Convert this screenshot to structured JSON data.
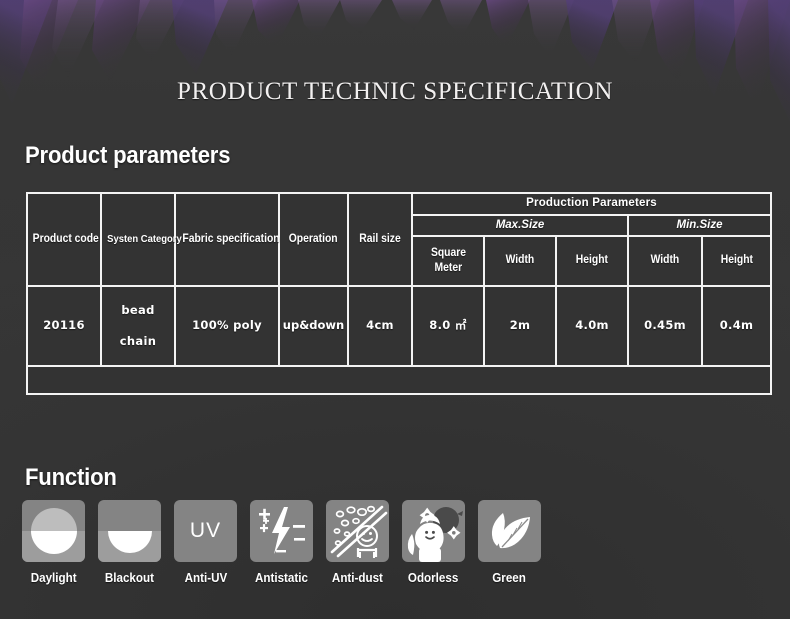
{
  "page": {
    "title": "PRODUCT TECHNIC SPECIFICATION",
    "background_color": "#383838",
    "accent_color": "#5a3a6e",
    "text_color": "#ffffff"
  },
  "sections": {
    "product_parameters_heading": "Product parameters",
    "function_heading": "Function"
  },
  "table": {
    "group_header": "Production Parameters",
    "subgroups": [
      {
        "label": "Max.Size"
      },
      {
        "label": "Min.Size"
      }
    ],
    "columns": [
      "Product code",
      "Systen Category",
      "Fabric specification",
      "Operation",
      "Rail size",
      "Square Meter",
      "Width",
      "Height",
      "Width",
      "Height"
    ],
    "column_square_meter_line1": "Square",
    "column_square_meter_line2": "Meter",
    "rows": [
      {
        "product_code": "20116",
        "system_category_line1": "bead",
        "system_category_line2": "chain",
        "fabric_specification": "100% poly",
        "operation": "up&down",
        "rail_size": "4cm",
        "max_square_meter": "8.0 ㎡",
        "max_width": "2m",
        "max_height": "4.0m",
        "min_width": "0.45m",
        "min_height": "0.4m"
      }
    ]
  },
  "functions": [
    {
      "label": "Daylight",
      "icon": "daylight-half-circle-icon"
    },
    {
      "label": "Blackout",
      "icon": "blackout-half-circle-icon"
    },
    {
      "label": "Anti-UV",
      "icon": "uv-text-icon",
      "glyph": "UV"
    },
    {
      "label": "Antistatic",
      "icon": "lightning-bolt-icon"
    },
    {
      "label": "Anti-dust",
      "icon": "dust-barrier-icon"
    },
    {
      "label": "Odorless",
      "icon": "girl-flower-icon"
    },
    {
      "label": "Green",
      "icon": "leaf-icon"
    }
  ]
}
